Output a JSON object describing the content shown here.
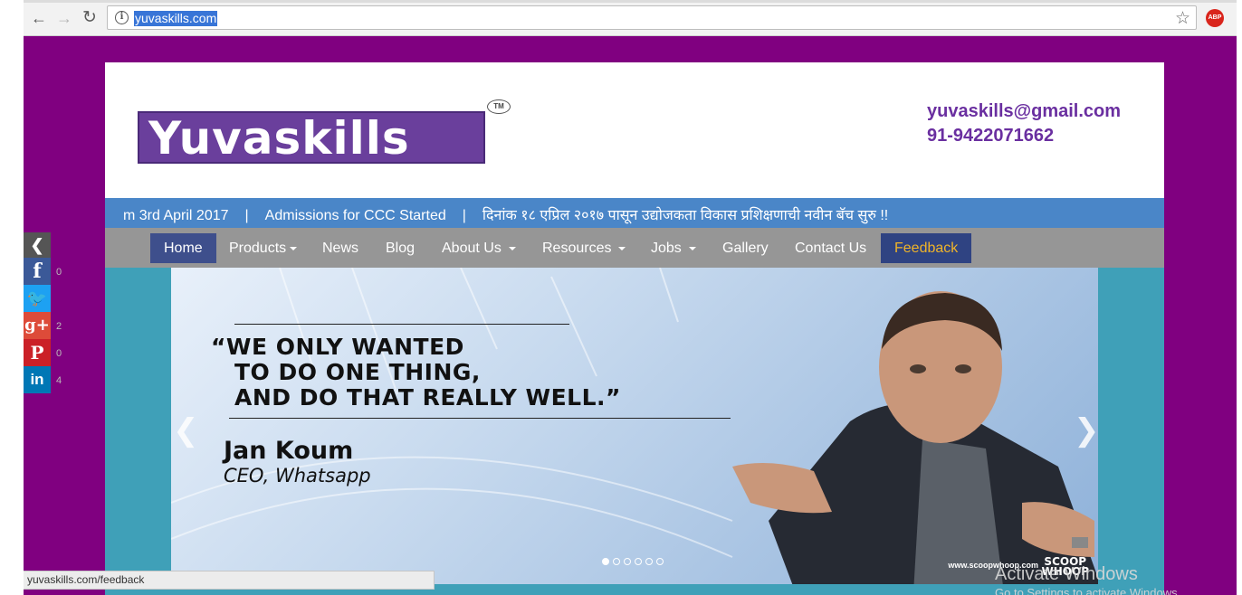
{
  "browser": {
    "url": "yuvaskills.com",
    "back_icon": "arrow-left-icon",
    "forward_icon": "arrow-right-icon",
    "reload_icon": "reload-icon",
    "info_icon": "info-icon",
    "bookmark_icon": "star-icon",
    "adblock_label": "ABP"
  },
  "header": {
    "logo_text": "Yuvaskills",
    "tm": "TM",
    "email": "yuvaskills@gmail.com",
    "phone": "91-9422071662"
  },
  "ticker": {
    "items": [
      "m 3rd April 2017",
      "Admissions for CCC Started",
      "दिनांक १८ एप्रिल २०१७ पासून उद्योजकता विकास प्रशिक्षणाची नवीन बॅच सुरु !!"
    ],
    "separator": "|"
  },
  "nav": {
    "items": [
      {
        "label": "Home",
        "dropdown": false
      },
      {
        "label": "Products",
        "dropdown": true
      },
      {
        "label": "News",
        "dropdown": false
      },
      {
        "label": "Blog",
        "dropdown": false
      },
      {
        "label": "About Us",
        "dropdown": true
      },
      {
        "label": "Resources",
        "dropdown": true
      },
      {
        "label": "Jobs",
        "dropdown": true
      },
      {
        "label": "Gallery",
        "dropdown": false
      },
      {
        "label": "Contact Us",
        "dropdown": false
      },
      {
        "label": "Feedback",
        "dropdown": false
      }
    ],
    "active": "Home"
  },
  "slider": {
    "quote_lines": [
      "“WE ONLY WANTED",
      "TO DO ONE THING,",
      "AND DO THAT REALLY WELL.”"
    ],
    "author": "Jan Koum",
    "author_title": "CEO, Whatsapp",
    "credit": "www.scoopwhoop.com",
    "brand_lines": [
      "SCOOP",
      "WHOOP"
    ],
    "slide_count": 6,
    "active_slide": 1
  },
  "share": {
    "buttons": [
      {
        "network": "facebook",
        "glyph": "f",
        "count": "0",
        "color": "#3b5998"
      },
      {
        "network": "twitter",
        "glyph": "t",
        "count": "",
        "color": "#1da1f2"
      },
      {
        "network": "google-plus",
        "glyph": "g+",
        "count": "2",
        "color": "#dd4b39"
      },
      {
        "network": "pinterest",
        "glyph": "P",
        "count": "0",
        "color": "#cb2027"
      },
      {
        "network": "linkedin",
        "glyph": "in",
        "count": "4",
        "color": "#0077b5"
      }
    ]
  },
  "status_bar": "yuvaskills.com/feedback",
  "watermark": {
    "line1": "Activate Windows",
    "line2": "Go to Settings to activate Windows."
  },
  "colors": {
    "page_bg": "#800080",
    "ticker_bg": "#4a86c8",
    "nav_bg": "#969696",
    "nav_active": "#3e4f8c",
    "feedback_text": "#f0b429",
    "brand_purple": "#6a3f9c"
  }
}
